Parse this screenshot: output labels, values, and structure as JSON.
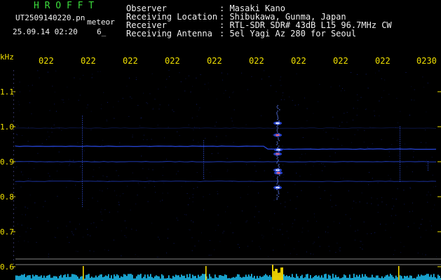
{
  "header": {
    "logo": "H R O F F T",
    "filename": "UT2509140220.pn",
    "meteor_label": "meteor",
    "datetime": "25.09.14 02:20",
    "count": "6_",
    "fields": [
      {
        "label": "Observer",
        "value": ": Masaki Kano"
      },
      {
        "label": "Receiving Location",
        "value": ": Shibukawa, Gunma, Japan"
      },
      {
        "label": "Receiver",
        "value": ": RTL-SDR SDR# 43dB L15 96.7MHz CW"
      },
      {
        "label": "Receiving Antenna",
        "value": ": 5el Yagi Az 280 for Seoul"
      }
    ]
  },
  "y_axis": {
    "unit": "kHz",
    "ticks": [
      "1.1",
      "1.0",
      "0.9",
      "0.8",
      "0.7",
      "0.6"
    ]
  },
  "time_axis": {
    "labels": [
      "022",
      "022",
      "022",
      "022",
      "022",
      "022",
      "022",
      "022",
      "022",
      "0230"
    ]
  },
  "colors": {
    "background": "#000000",
    "header_green": "#3cdc3c",
    "header_text": "#f0f0f0",
    "axis_labels": "#f0e000",
    "trace_blue": "#2848e0",
    "meteor_echo": "#ff6060",
    "bottom_power": "#1ec8ff",
    "meteor_power": "#ffe000"
  }
}
